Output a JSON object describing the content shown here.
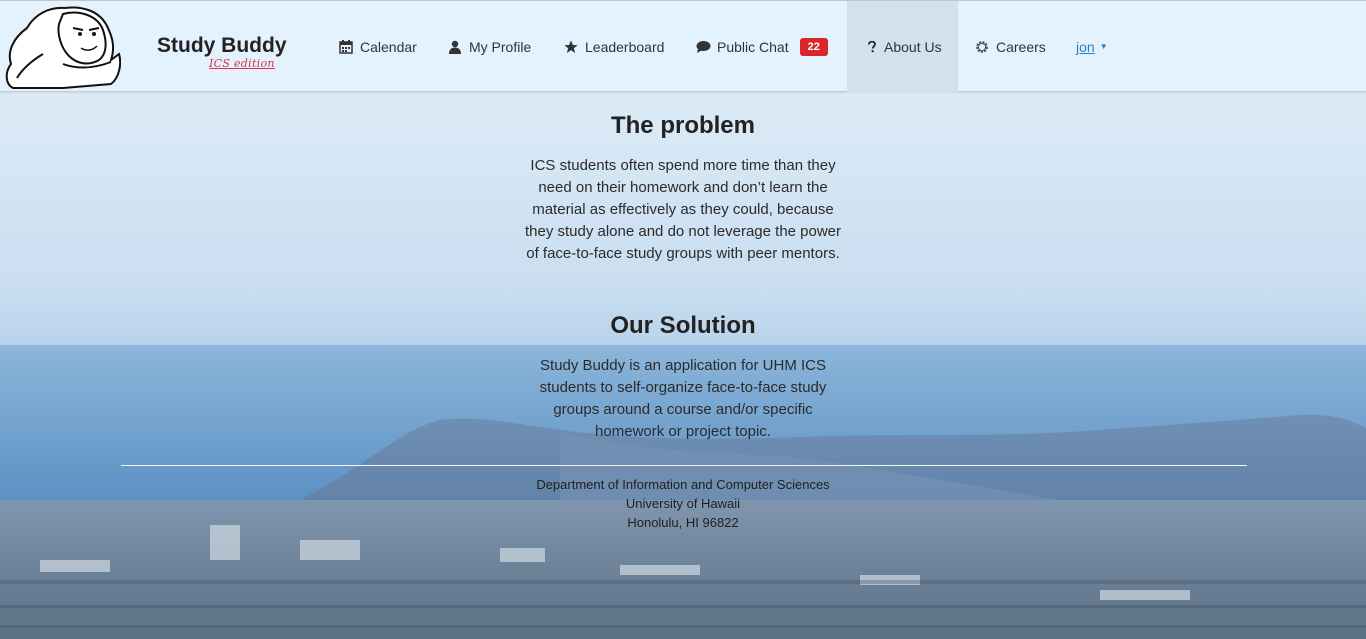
{
  "brand": {
    "title": "Study Buddy",
    "subtitle": "ICS edition"
  },
  "nav": {
    "items": [
      {
        "label": "Calendar",
        "icon": "calendar-icon"
      },
      {
        "label": "My Profile",
        "icon": "user-icon"
      },
      {
        "label": "Leaderboard",
        "icon": "star-icon"
      },
      {
        "label": "Public Chat",
        "icon": "chat-icon",
        "badge": "22"
      },
      {
        "label": "About Us",
        "icon": "question-icon",
        "active": true
      },
      {
        "label": "Careers",
        "icon": "gear-icon"
      }
    ],
    "user": "jon"
  },
  "main": {
    "problem": {
      "title": "The problem",
      "text": "ICS students often spend more time than they need on their homework and don’t learn the material as effectively as they could, because they study alone and do not leverage the power of face-to-face study groups with peer mentors."
    },
    "solution": {
      "title": "Our Solution",
      "text": "Study Buddy is an application for UHM ICS students to self-organize face-to-face study groups around a course and/or specific homework or project topic."
    }
  },
  "footer": {
    "line1": "Department of Information and Computer Sciences",
    "line2": "University of Hawaii",
    "line3": "Honolulu, HI 96822"
  },
  "colors": {
    "navbar_bg": "#e3f2fd",
    "active_tab": "#d3e1ec",
    "badge": "#d9262b",
    "brand_sub": "#d9363e",
    "link": "#2a7fc0"
  }
}
